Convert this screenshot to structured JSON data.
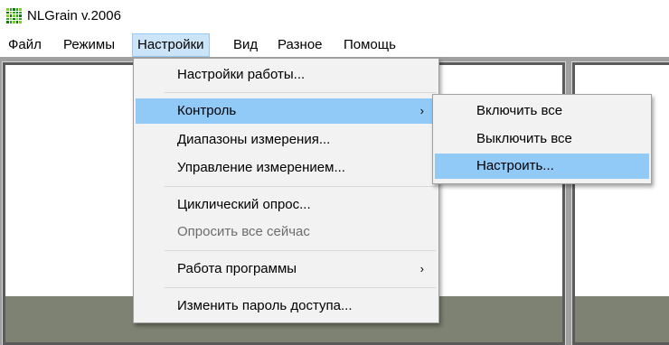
{
  "window": {
    "title": "NLGrain v.2006",
    "icon": "grain-grid-icon"
  },
  "menubar": {
    "items": [
      {
        "label": "Файл"
      },
      {
        "label": "Режимы"
      },
      {
        "label": "Настройки",
        "active": true
      },
      {
        "label": "Вид"
      },
      {
        "label": "Разное"
      },
      {
        "label": "Помощь"
      }
    ]
  },
  "settings_menu": {
    "items": [
      {
        "label": "Настройки работы..."
      },
      {
        "label": "Контроль",
        "has_submenu": true,
        "highlighted": true
      },
      {
        "label": "Диапазоны измерения..."
      },
      {
        "label": "Управление измерением..."
      },
      {
        "label": "Циклический опрос..."
      },
      {
        "label": "Опросить все сейчас",
        "disabled": true
      },
      {
        "label": "Работа программы",
        "has_submenu": true
      },
      {
        "label": "Изменить пароль доступа..."
      }
    ],
    "submenu_arrow": "›"
  },
  "control_submenu": {
    "items": [
      {
        "label": "Включить все"
      },
      {
        "label": "Выключить все"
      },
      {
        "label": "Настроить...",
        "highlighted": true
      }
    ]
  },
  "colors": {
    "menu_highlight": "#91c9f7",
    "menubar_active": "#cce4f7",
    "panel_footer": "#7d8272",
    "workspace": "#a0a0a0"
  }
}
